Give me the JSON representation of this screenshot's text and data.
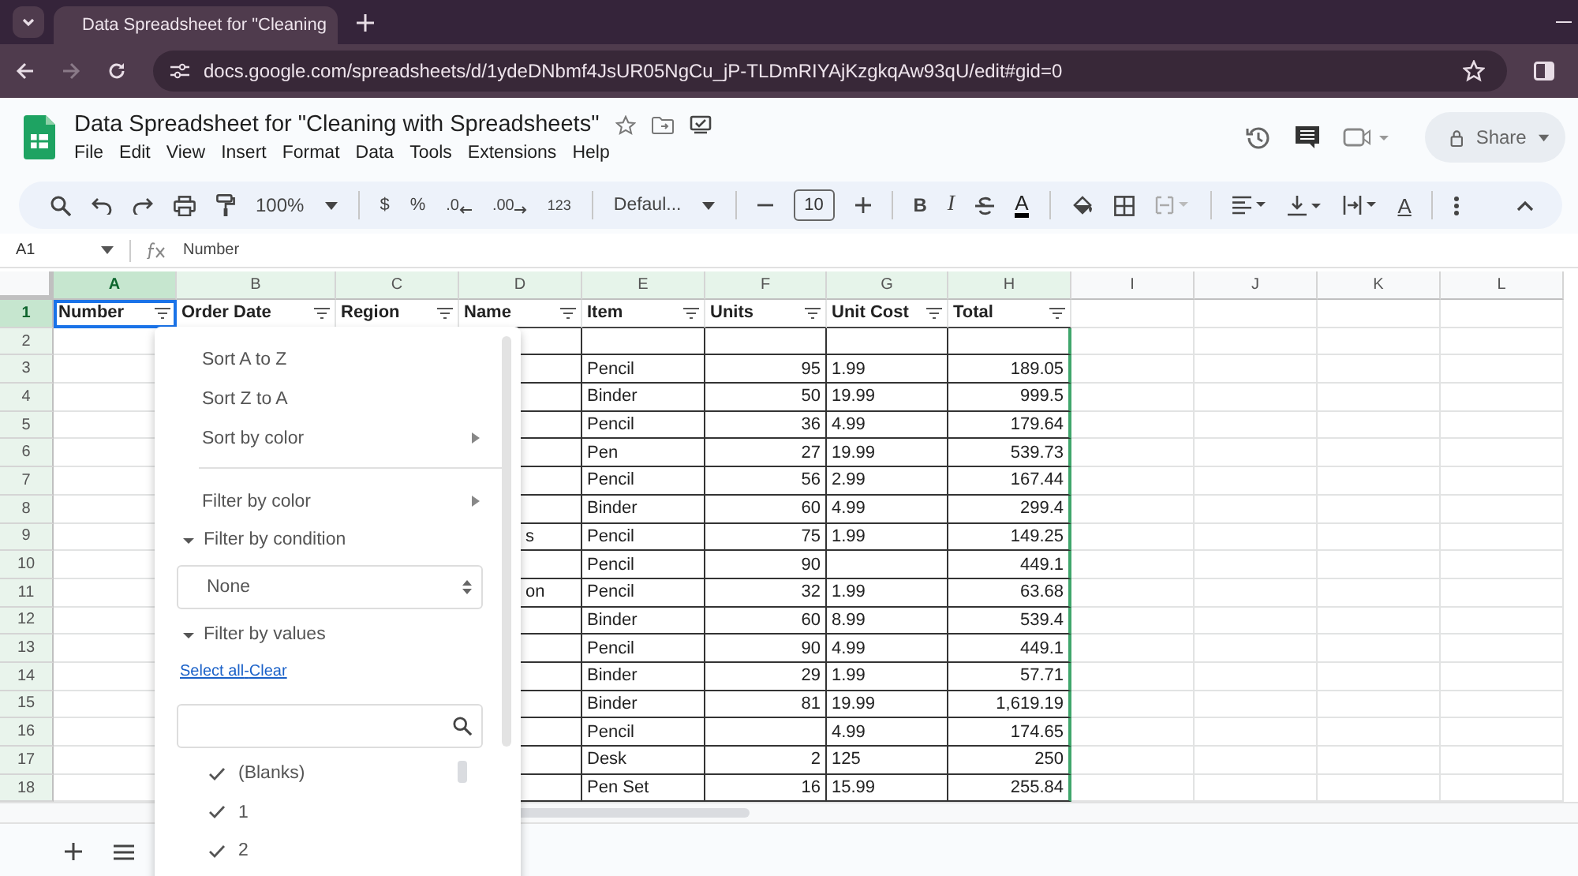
{
  "browser": {
    "tab_title": "Data Spreadsheet for \"Cleaning",
    "url": "docs.google.com/spreadsheets/d/1ydeDNbmf4JsUR05NgCu_jP-TLDmRIYAjKzgkqAw93qU/edit#gid=0"
  },
  "document": {
    "title": "Data Spreadsheet for \"Cleaning with Spreadsheets\"",
    "menus": [
      "File",
      "Edit",
      "View",
      "Insert",
      "Format",
      "Data",
      "Tools",
      "Extensions",
      "Help"
    ],
    "share": "Share"
  },
  "toolbar": {
    "zoom": "100%",
    "currency": "$",
    "percent": "%",
    "decrease_decimals": ".0",
    "increase_decimals": ".00",
    "number_format": "123",
    "font": "Defaul...",
    "font_size": "10",
    "bold": "B",
    "italic": "I",
    "text_color": "A",
    "text_rotation": "A"
  },
  "formula_bar": {
    "cell": "A1",
    "formula": "Number"
  },
  "columns": [
    {
      "letter": "A",
      "selected": true
    },
    {
      "letter": "B",
      "selected": false
    },
    {
      "letter": "C",
      "selected": false
    },
    {
      "letter": "D",
      "selected": false
    },
    {
      "letter": "E",
      "selected": false
    },
    {
      "letter": "F",
      "selected": false
    },
    {
      "letter": "G",
      "selected": false
    },
    {
      "letter": "H",
      "selected": false
    },
    {
      "letter": "I",
      "selected": false
    },
    {
      "letter": "J",
      "selected": false
    },
    {
      "letter": "K",
      "selected": false
    },
    {
      "letter": "L",
      "selected": false
    }
  ],
  "header_row": {
    "num": "1",
    "selected": true,
    "labels": [
      "Number",
      "Order Date",
      "Region",
      "Name",
      "Item",
      "Units",
      "Unit Cost",
      "Total"
    ]
  },
  "rows": [
    {
      "num": "2",
      "selected": false
    },
    {
      "num": "3",
      "selected": false,
      "item": "Pencil",
      "units": "95",
      "unit_cost": "1.99",
      "total": "189.05"
    },
    {
      "num": "4",
      "selected": false,
      "item": "Binder",
      "units": "50",
      "unit_cost": "19.99",
      "total": "999.5"
    },
    {
      "num": "5",
      "selected": false,
      "item": "Pencil",
      "units": "36",
      "unit_cost": "4.99",
      "total": "179.64"
    },
    {
      "num": "6",
      "selected": false,
      "item": "Pen",
      "units": "27",
      "unit_cost": "19.99",
      "total": "539.73"
    },
    {
      "num": "7",
      "selected": false,
      "item": "Pencil",
      "units": "56",
      "unit_cost": "2.99",
      "total": "167.44"
    },
    {
      "num": "8",
      "selected": false,
      "item": "Binder",
      "units": "60",
      "unit_cost": "4.99",
      "total": "299.4"
    },
    {
      "num": "9",
      "selected": false,
      "name": "s",
      "item": "Pencil",
      "units": "75",
      "unit_cost": "1.99",
      "total": "149.25"
    },
    {
      "num": "10",
      "selected": false,
      "item": "Pencil",
      "units": "90",
      "total": "449.1"
    },
    {
      "num": "11",
      "selected": false,
      "name": "on",
      "item": "Pencil",
      "units": "32",
      "unit_cost": "1.99",
      "total": "63.68"
    },
    {
      "num": "12",
      "selected": false,
      "item": "Binder",
      "units": "60",
      "unit_cost": "8.99",
      "total": "539.4"
    },
    {
      "num": "13",
      "selected": false,
      "item": "Pencil",
      "units": "90",
      "unit_cost": "4.99",
      "total": "449.1"
    },
    {
      "num": "14",
      "selected": false,
      "item": "Binder",
      "units": "29",
      "unit_cost": "1.99",
      "total": "57.71"
    },
    {
      "num": "15",
      "selected": false,
      "item": "Binder",
      "units": "81",
      "unit_cost": "19.99",
      "total": "1,619.19"
    },
    {
      "num": "16",
      "selected": false,
      "item": "Pencil",
      "unit_cost": "4.99",
      "total": "174.65"
    },
    {
      "num": "17",
      "selected": false,
      "item": "Desk",
      "units": "2",
      "unit_cost": "125",
      "total": "250"
    },
    {
      "num": "18",
      "selected": false,
      "item": "Pen Set",
      "units": "16",
      "unit_cost": "15.99",
      "total": "255.84"
    }
  ],
  "filter_menu": {
    "items": [
      {
        "kind": "action",
        "label": "Sort A to Z"
      },
      {
        "kind": "action",
        "label": "Sort Z to A"
      },
      {
        "kind": "submenu",
        "label": "Sort by color"
      },
      {
        "kind": "divider"
      },
      {
        "kind": "submenu",
        "label": "Filter by color"
      }
    ],
    "condition": {
      "label": "Filter by condition",
      "expanded": true,
      "value": "None"
    },
    "values": {
      "label": "Filter by values",
      "expanded": true,
      "select_all": "Select all",
      "separator": "-",
      "clear": "Clear",
      "options": [
        {
          "label": "(Blanks)",
          "checked": true
        },
        {
          "label": "1",
          "checked": true
        },
        {
          "label": "2",
          "checked": true
        }
      ]
    }
  }
}
